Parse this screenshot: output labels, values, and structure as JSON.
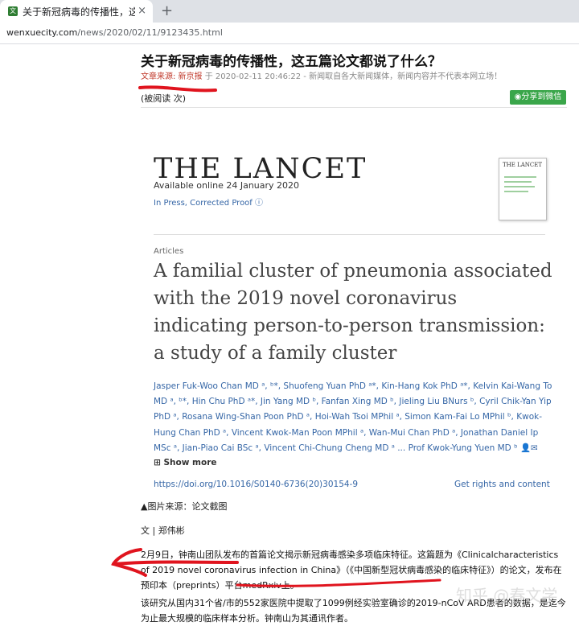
{
  "browser": {
    "tab_title": "关于新冠病毒的传播性，这",
    "tab_close": "×",
    "new_tab": "+",
    "url_domain": "wenxuecity.com",
    "url_path": "/news/2020/02/11/9123435.html"
  },
  "article": {
    "title": "关于新冠病毒的传播性，这五篇论文都说了什么？",
    "source_label": "文章来源: 新京报",
    "date_text": " 于 2020-02-11 20:46:22 - 新闻取自各大新闻媒体，新闻内容并不代表本网立场！",
    "reads": "(被阅读 次)",
    "share_button": "分享到微信"
  },
  "lancet": {
    "logo": "THE LANCET",
    "available": "Available online 24 January 2020",
    "in_press": "In Press, Corrected Proof ⓘ",
    "cover_title": "THE LANCET",
    "section_label": "Articles",
    "paper_title": "A familial cluster of pneumonia associated with the 2019 novel coronavirus indicating person-to-person transmission: a study of a family cluster",
    "authors": "Jasper Fuk-Woo Chan MD ᵃ, ᵇ*, Shuofeng Yuan PhD ᵃ*, Kin-Hang Kok PhD ᵃ*, Kelvin Kai-Wang To MD ᵃ, ᵇ*, Hin Chu PhD ᵃ*, Jin Yang MD ᵇ, Fanfan Xing MD ᵇ, Jieling Liu BNurs ᵇ, Cyril Chik-Yan Yip PhD ᵃ, Rosana Wing-Shan Poon PhD ᵃ, Hoi-Wah Tsoi MPhil ᵃ, Simon Kam-Fai Lo MPhil ᵇ, Kwok-Hung Chan PhD ᵃ, Vincent Kwok-Man Poon MPhil ᵃ, Wan-Mui Chan PhD ᵃ, Jonathan Daniel Ip MSc ᵃ, Jian-Piao Cai BSc ᵃ, Vincent Chi-Chung Cheng MD ᵃ ... Prof Kwok-Yung Yuen MD ᵇ 👤✉",
    "show_more": "⊞ Show more",
    "doi": "https://doi.org/10.1016/S0140-6736(20)30154-9",
    "rights": "Get rights and content"
  },
  "body": {
    "caption": "▲图片来源：论文截图",
    "byline": "文 | 郑伟彬",
    "para1": "2月9日，钟南山团队发布的首篇论文揭示新冠病毒感染多项临床特征。这篇题为《Clinicalcharacteristics of 2019 novel coronavirus infection in China》（《中国新型冠状病毒感染的临床特征》）的论文，发布在预印本（preprints）平台medRxiv上。",
    "para2": "该研究从国内31个省/市的552家医院中提取了1099例经实验室确诊的2019-nCoV ARD患者的数据，是迄今为止最大规模的临床样本分析。钟南山为其通讯作者。",
    "watermark": "知乎 @春文学"
  }
}
